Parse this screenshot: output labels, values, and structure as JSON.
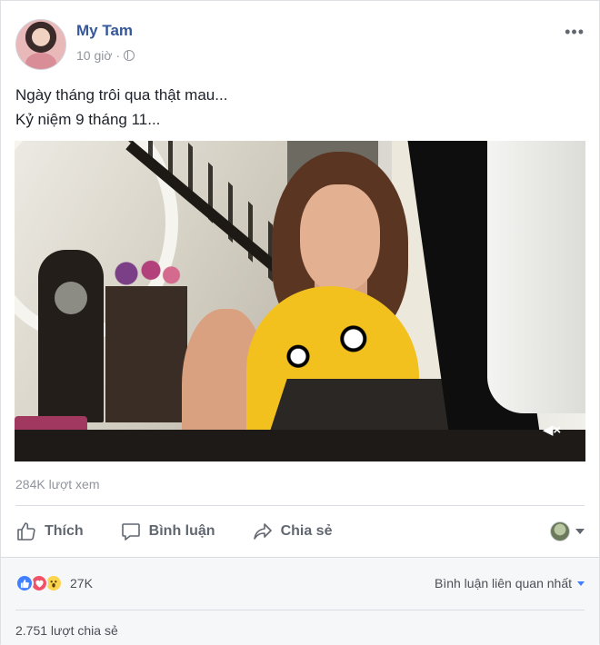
{
  "post": {
    "author": "My Tam",
    "time": "10 giờ",
    "dot": "·",
    "more": "•••",
    "text_line1": "Ngày tháng trôi qua thật mau...",
    "text_line2": "Kỷ niệm 9 tháng 11..."
  },
  "video": {
    "mute_glyph": "◀×",
    "muted": true
  },
  "stats": {
    "views": "284K lượt xem",
    "reaction_count": "27K",
    "reaction_types": [
      "like-icon",
      "love-icon",
      "wow-icon"
    ],
    "shares": "2.751 lượt chia sẻ"
  },
  "actions": {
    "like": "Thích",
    "comment": "Bình luận",
    "share": "Chia sẻ"
  },
  "comments": {
    "sort_label": "Bình luận liên quan nhất"
  },
  "colors": {
    "author": "#365899",
    "meta": "#90949c",
    "action": "#616770",
    "like": "#4080ff",
    "love": "#f25268",
    "wow": "#fcd44e"
  }
}
